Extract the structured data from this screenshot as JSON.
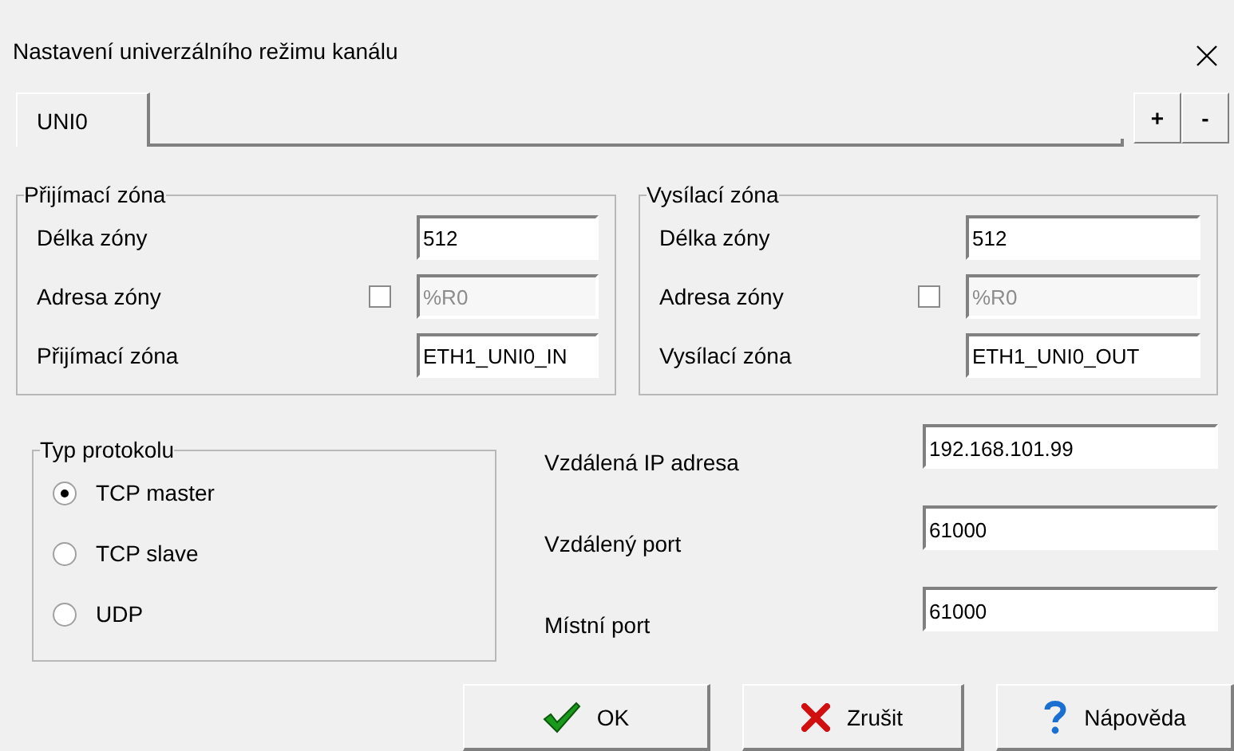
{
  "window": {
    "title": "Nastavení univerzálního režimu kanálu"
  },
  "tabs": [
    {
      "label": "UNI0",
      "selected": true
    }
  ],
  "tab_buttons": [
    "+",
    "-"
  ],
  "zones": [
    {
      "title": "Přijímací zóna",
      "rows": [
        {
          "kind": "field",
          "label": "Délka zóny",
          "value": "512"
        },
        {
          "kind": "checkbox_field",
          "label": "Adresa zóny",
          "checked": false,
          "value": "%R0",
          "disabled": true
        },
        {
          "kind": "field",
          "label": "Přijímací zóna",
          "value": "ETH1_UNI0_IN"
        }
      ]
    },
    {
      "title": "Vysílací zóna",
      "rows": [
        {
          "kind": "field",
          "label": "Délka zóny",
          "value": "512"
        },
        {
          "kind": "checkbox_field",
          "label": "Adresa zóny",
          "checked": false,
          "value": "%R0",
          "disabled": true
        },
        {
          "kind": "field",
          "label": "Vysílací zóna",
          "value": "ETH1_UNI0_OUT"
        }
      ]
    }
  ],
  "protocol": {
    "title": "Typ protokolu",
    "options": [
      {
        "label": "TCP master",
        "selected": true
      },
      {
        "label": "TCP slave",
        "selected": false
      },
      {
        "label": "UDP",
        "selected": false
      }
    ]
  },
  "network": [
    {
      "label": "Vzdálená IP adresa",
      "value": "192.168.101.99"
    },
    {
      "label": "Vzdálený port",
      "value": "61000"
    },
    {
      "label": "Místní port",
      "value": "61000"
    }
  ],
  "buttons": [
    {
      "kind": "ok",
      "label": "OK"
    },
    {
      "kind": "cancel",
      "label": "Zrušit"
    },
    {
      "kind": "help",
      "label": "Nápověda"
    }
  ]
}
